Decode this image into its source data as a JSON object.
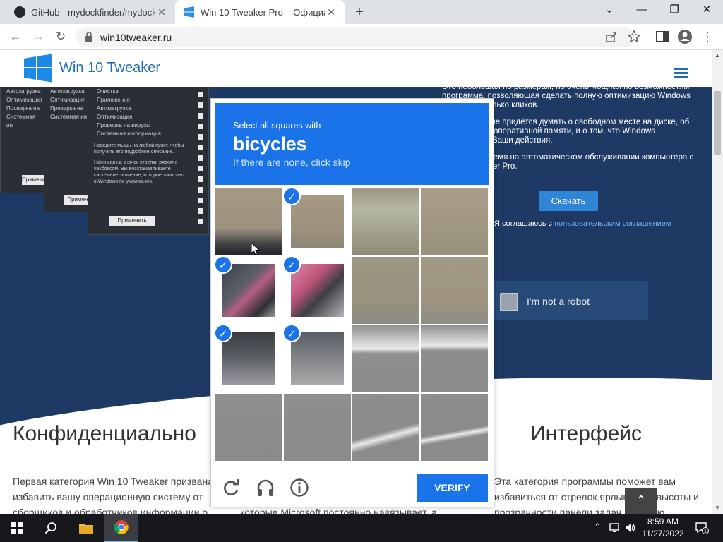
{
  "browser": {
    "tabs": [
      {
        "title": "GitHub - mydockfinder/mydockfi",
        "close": "✕"
      },
      {
        "title": "Win 10 Tweaker Pro – Официаль",
        "close": "✕"
      }
    ],
    "new_tab": "+",
    "window_controls": {
      "minimize": "—",
      "restore": "❐",
      "close": "✕",
      "tablist": "⌄"
    },
    "nav": {
      "back": "←",
      "forward": "→",
      "reload": "↻"
    },
    "url": "win10tweaker.ru"
  },
  "site": {
    "brand": "Win 10 Tweaker",
    "hero_paragraphs": [
      "Это небольшая по размерам, но очень мощная по возможностям программа, позволяющая сделать полную оптимизацию Windows всего в несколько кликов.",
      "Вам больше не придётся думать о свободном месте на диске, об оптимизации оперативной памяти, и о том, что Windows отслеживает Ваши действия.",
      "Экономьте время на автоматическом обслуживании компьютера с Win 10 Tweaker Pro."
    ],
    "download_label": "Скачать",
    "agree_text": "Я соглашаюсь с ",
    "agree_link": "пользовательским соглашением",
    "not_robot": "I'm not a robot",
    "section_left_title": "Конфиденциально",
    "section_right_title": "Интерфейс",
    "section_left_text": "Первая категория Win 10 Tweaker призвана избавить вашу операционную систему от сборщиков и обработчиков информации о",
    "section_mid_text": "которые Microsoft постоянно навязывает, а",
    "section_right_text": "Эта категория программы поможет вам избавиться от стрелок ярлыков, от высоты и прозрачности панели задач, от меню",
    "screenshot_menu": [
      "Очистка",
      "Приложения",
      "Автозагрузка",
      "Оптимизация",
      "Проверка на вирусы",
      "Системная информация"
    ],
    "screenshot_hint": "Наведите мышь на любой пункт, чтобы получить его подробное описание.",
    "screenshot_hint2": "Нажимая на значок стрелки рядом с чекбоксом, Вы восстанавливаете системное значение, которое записано в Windows по умолчанию.",
    "screenshot_apply": "Применить",
    "screenshot_left_items": [
      "Автозагрузка",
      "Оптимизация",
      "Проверка на",
      "Системная ин"
    ],
    "to_top": "⌃"
  },
  "captcha": {
    "instruction": "Select all squares with",
    "target": "bicycles",
    "hint": "If there are none, click skip",
    "verify_label": "VERIFY",
    "tick": "✓",
    "selected_tiles": [
      1,
      4,
      5,
      8,
      9
    ]
  },
  "taskbar": {
    "time": "8:59 AM",
    "date": "11/27/2022",
    "notifications": "1"
  }
}
